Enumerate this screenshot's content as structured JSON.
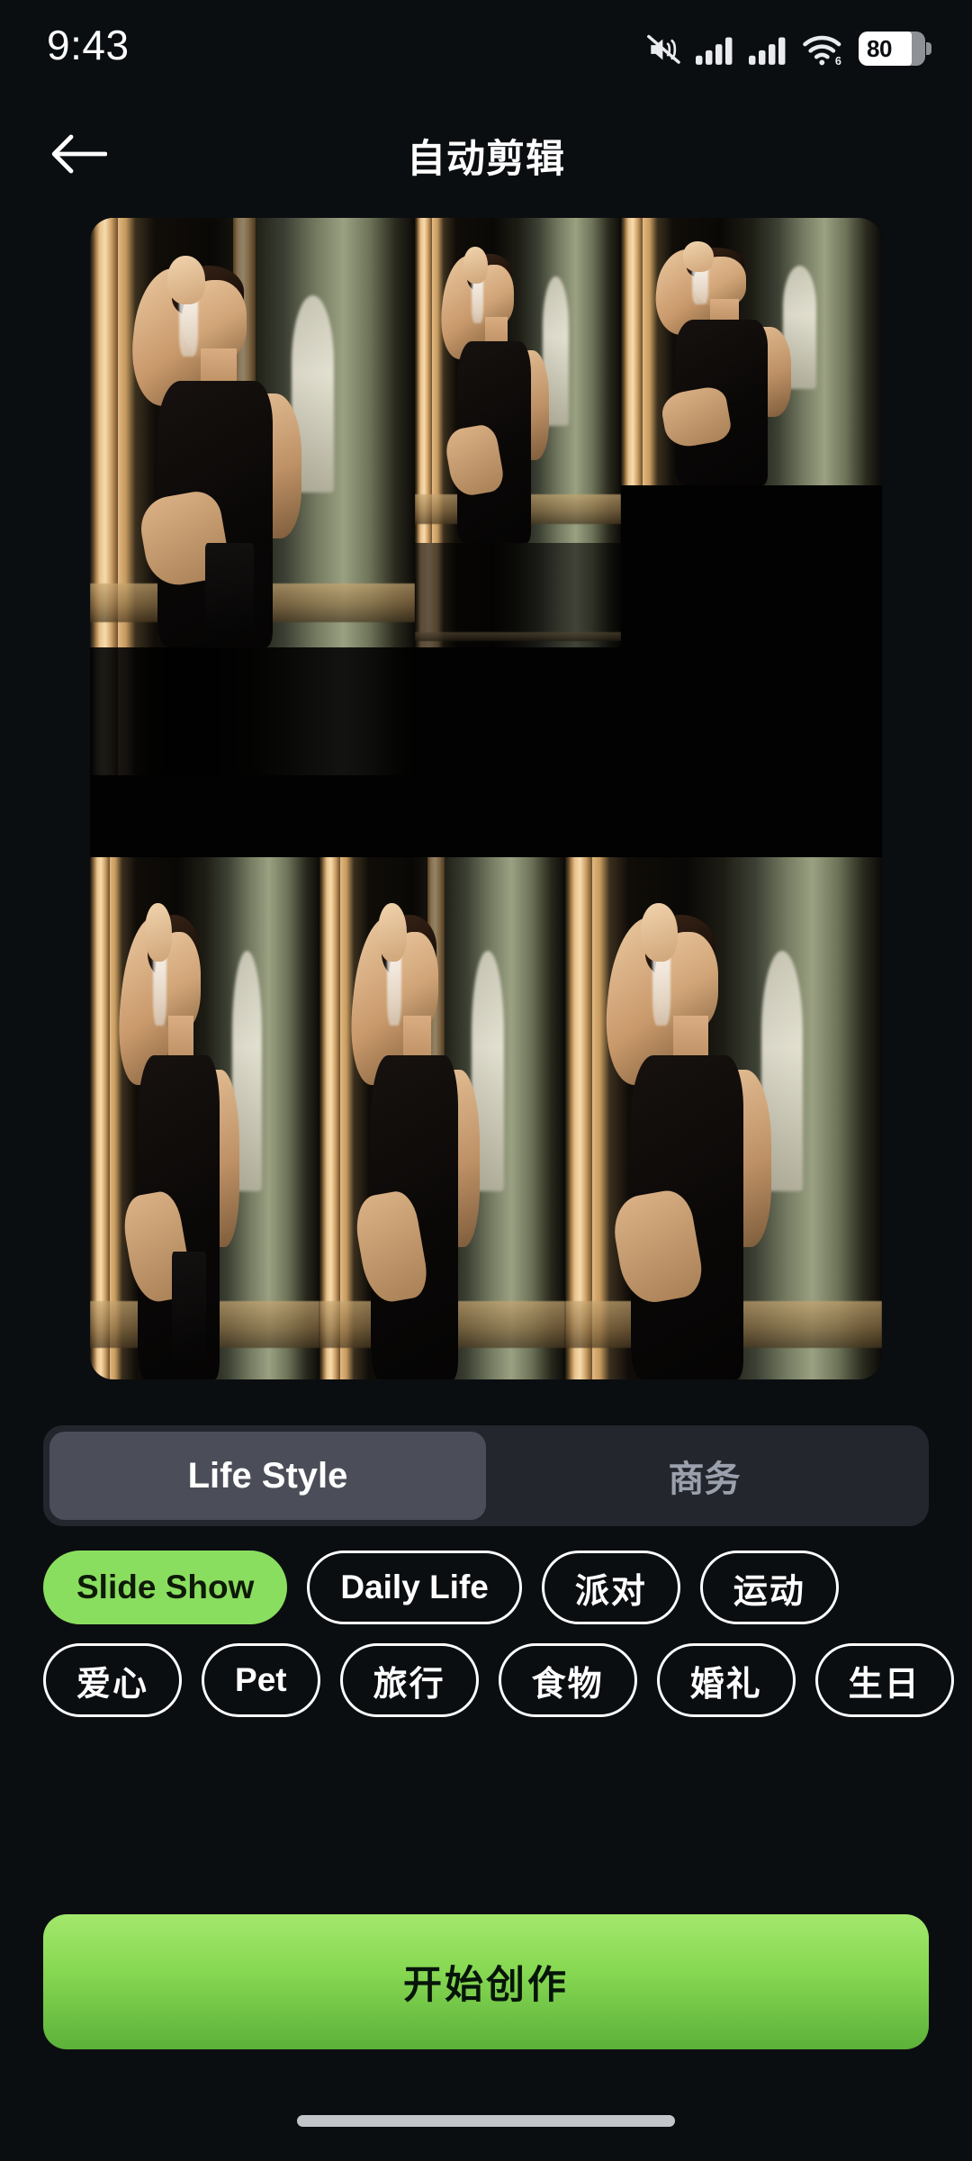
{
  "status_bar": {
    "time": "9:43",
    "battery_percent": "80",
    "icons": [
      "mute-icon",
      "signal-bars-icon",
      "signal-bars-icon",
      "wifi-6-icon",
      "battery-icon"
    ],
    "wifi_generation": "6"
  },
  "app_bar": {
    "title": "自动剪辑",
    "back_icon": "arrow-left-icon"
  },
  "preview": {
    "label": "video-preview-collage"
  },
  "segmented_control": {
    "selected_index": 0,
    "options": [
      {
        "label": "Life Style",
        "selected": true
      },
      {
        "label": "商务",
        "selected": false
      }
    ]
  },
  "template_chips": {
    "rows": [
      [
        {
          "label": "Slide Show",
          "selected": true
        },
        {
          "label": "Daily Life",
          "selected": false
        },
        {
          "label": "派对",
          "selected": false
        },
        {
          "label": "运动",
          "selected": false
        }
      ],
      [
        {
          "label": "爱心",
          "selected": false
        },
        {
          "label": "Pet",
          "selected": false
        },
        {
          "label": "旅行",
          "selected": false
        },
        {
          "label": "食物",
          "selected": false
        },
        {
          "label": "婚礼",
          "selected": false
        },
        {
          "label": "生日",
          "selected": false
        }
      ]
    ]
  },
  "cta": {
    "label": "开始创作"
  },
  "colors": {
    "background": "#0b0e11",
    "accent_green": "#8ade5f",
    "cta_gradient_top": "#a3e86c",
    "cta_gradient_bottom": "#5cb13a",
    "segment_track": "#23262c",
    "segment_active": "#4b4e58",
    "segment_idle_text": "#9aa0ac",
    "text_primary": "#ffffff"
  }
}
